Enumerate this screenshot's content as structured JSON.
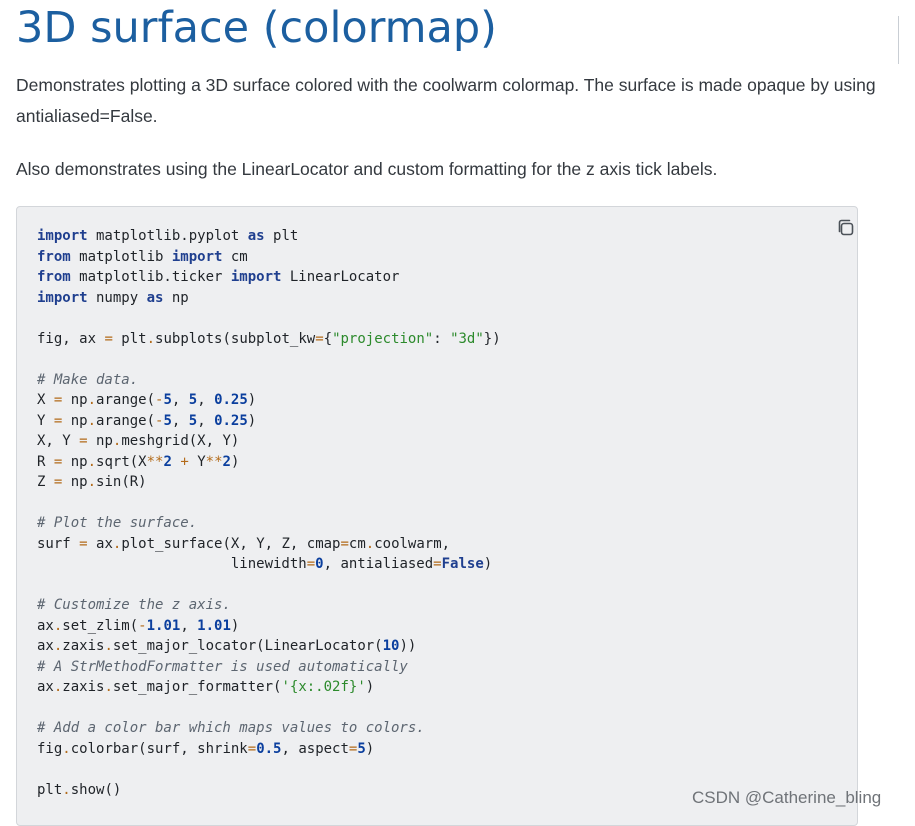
{
  "page": {
    "title": "3D surface (colormap)",
    "paragraph_1": "Demonstrates plotting a 3D surface colored with the coolwarm colormap. The surface is made opaque by using antialiased=False.",
    "paragraph_2": "Also demonstrates using the LinearLocator and custom formatting for the z axis tick labels."
  },
  "code_block": {
    "copy_icon": "copy-icon",
    "lines": [
      [
        [
          "kw",
          "import"
        ],
        [
          "p",
          " matplotlib.pyplot "
        ],
        [
          "kw",
          "as"
        ],
        [
          "p",
          " plt"
        ]
      ],
      [
        [
          "kw",
          "from"
        ],
        [
          "p",
          " matplotlib "
        ],
        [
          "kw",
          "import"
        ],
        [
          "p",
          " cm"
        ]
      ],
      [
        [
          "kw",
          "from"
        ],
        [
          "p",
          " matplotlib.ticker "
        ],
        [
          "kw",
          "import"
        ],
        [
          "p",
          " LinearLocator"
        ]
      ],
      [
        [
          "kw",
          "import"
        ],
        [
          "p",
          " numpy "
        ],
        [
          "kw",
          "as"
        ],
        [
          "p",
          " np"
        ]
      ],
      [],
      [
        [
          "p",
          "fig, ax "
        ],
        [
          "op",
          "="
        ],
        [
          "p",
          " plt"
        ],
        [
          "op",
          "."
        ],
        [
          "p",
          "subplots(subplot_kw"
        ],
        [
          "op",
          "="
        ],
        [
          "p",
          "{"
        ],
        [
          "str",
          "\"projection\""
        ],
        [
          "p",
          ": "
        ],
        [
          "str",
          "\"3d\""
        ],
        [
          "p",
          "})"
        ]
      ],
      [],
      [
        [
          "com",
          "# Make data."
        ]
      ],
      [
        [
          "p",
          "X "
        ],
        [
          "op",
          "="
        ],
        [
          "p",
          " np"
        ],
        [
          "op",
          "."
        ],
        [
          "p",
          "arange("
        ],
        [
          "op",
          "-"
        ],
        [
          "num",
          "5"
        ],
        [
          "p",
          ", "
        ],
        [
          "num",
          "5"
        ],
        [
          "p",
          ", "
        ],
        [
          "num",
          "0.25"
        ],
        [
          "p",
          ")"
        ]
      ],
      [
        [
          "p",
          "Y "
        ],
        [
          "op",
          "="
        ],
        [
          "p",
          " np"
        ],
        [
          "op",
          "."
        ],
        [
          "p",
          "arange("
        ],
        [
          "op",
          "-"
        ],
        [
          "num",
          "5"
        ],
        [
          "p",
          ", "
        ],
        [
          "num",
          "5"
        ],
        [
          "p",
          ", "
        ],
        [
          "num",
          "0.25"
        ],
        [
          "p",
          ")"
        ]
      ],
      [
        [
          "p",
          "X, Y "
        ],
        [
          "op",
          "="
        ],
        [
          "p",
          " np"
        ],
        [
          "op",
          "."
        ],
        [
          "p",
          "meshgrid(X, Y)"
        ]
      ],
      [
        [
          "p",
          "R "
        ],
        [
          "op",
          "="
        ],
        [
          "p",
          " np"
        ],
        [
          "op",
          "."
        ],
        [
          "p",
          "sqrt(X"
        ],
        [
          "op",
          "**"
        ],
        [
          "num",
          "2"
        ],
        [
          "p",
          " "
        ],
        [
          "op",
          "+"
        ],
        [
          "p",
          " Y"
        ],
        [
          "op",
          "**"
        ],
        [
          "num",
          "2"
        ],
        [
          "p",
          ")"
        ]
      ],
      [
        [
          "p",
          "Z "
        ],
        [
          "op",
          "="
        ],
        [
          "p",
          " np"
        ],
        [
          "op",
          "."
        ],
        [
          "p",
          "sin(R)"
        ]
      ],
      [],
      [
        [
          "com",
          "# Plot the surface."
        ]
      ],
      [
        [
          "p",
          "surf "
        ],
        [
          "op",
          "="
        ],
        [
          "p",
          " ax"
        ],
        [
          "op",
          "."
        ],
        [
          "p",
          "plot_surface(X, Y, Z, cmap"
        ],
        [
          "op",
          "="
        ],
        [
          "p",
          "cm"
        ],
        [
          "op",
          "."
        ],
        [
          "p",
          "coolwarm,"
        ]
      ],
      [
        [
          "p",
          "                       linewidth"
        ],
        [
          "op",
          "="
        ],
        [
          "num",
          "0"
        ],
        [
          "p",
          ", antialiased"
        ],
        [
          "op",
          "="
        ],
        [
          "const",
          "False"
        ],
        [
          "p",
          ")"
        ]
      ],
      [],
      [
        [
          "com",
          "# Customize the z axis."
        ]
      ],
      [
        [
          "p",
          "ax"
        ],
        [
          "op",
          "."
        ],
        [
          "p",
          "set_zlim("
        ],
        [
          "op",
          "-"
        ],
        [
          "num",
          "1.01"
        ],
        [
          "p",
          ", "
        ],
        [
          "num",
          "1.01"
        ],
        [
          "p",
          ")"
        ]
      ],
      [
        [
          "p",
          "ax"
        ],
        [
          "op",
          "."
        ],
        [
          "p",
          "zaxis"
        ],
        [
          "op",
          "."
        ],
        [
          "p",
          "set_major_locator(LinearLocator("
        ],
        [
          "num",
          "10"
        ],
        [
          "p",
          "))"
        ]
      ],
      [
        [
          "com",
          "# A StrMethodFormatter is used automatically"
        ]
      ],
      [
        [
          "p",
          "ax"
        ],
        [
          "op",
          "."
        ],
        [
          "p",
          "zaxis"
        ],
        [
          "op",
          "."
        ],
        [
          "p",
          "set_major_formatter("
        ],
        [
          "str",
          "'{x:.02f}'"
        ],
        [
          "p",
          ")"
        ]
      ],
      [],
      [
        [
          "com",
          "# Add a color bar which maps values to colors."
        ]
      ],
      [
        [
          "p",
          "fig"
        ],
        [
          "op",
          "."
        ],
        [
          "p",
          "colorbar(surf, shrink"
        ],
        [
          "op",
          "="
        ],
        [
          "num",
          "0.5"
        ],
        [
          "p",
          ", aspect"
        ],
        [
          "op",
          "="
        ],
        [
          "num",
          "5"
        ],
        [
          "p",
          ")"
        ]
      ],
      [],
      [
        [
          "p",
          "plt"
        ],
        [
          "op",
          "."
        ],
        [
          "p",
          "show()"
        ]
      ]
    ]
  },
  "watermark": "CSDN @Catherine_bling",
  "colors": {
    "title": "#1c5fa0",
    "keyword": "#1f3f8f",
    "number": "#0b3f9e",
    "string": "#2c8a2c",
    "comment": "#5d6671",
    "operator": "#b36b1a",
    "code_background": "#eeeff1"
  }
}
